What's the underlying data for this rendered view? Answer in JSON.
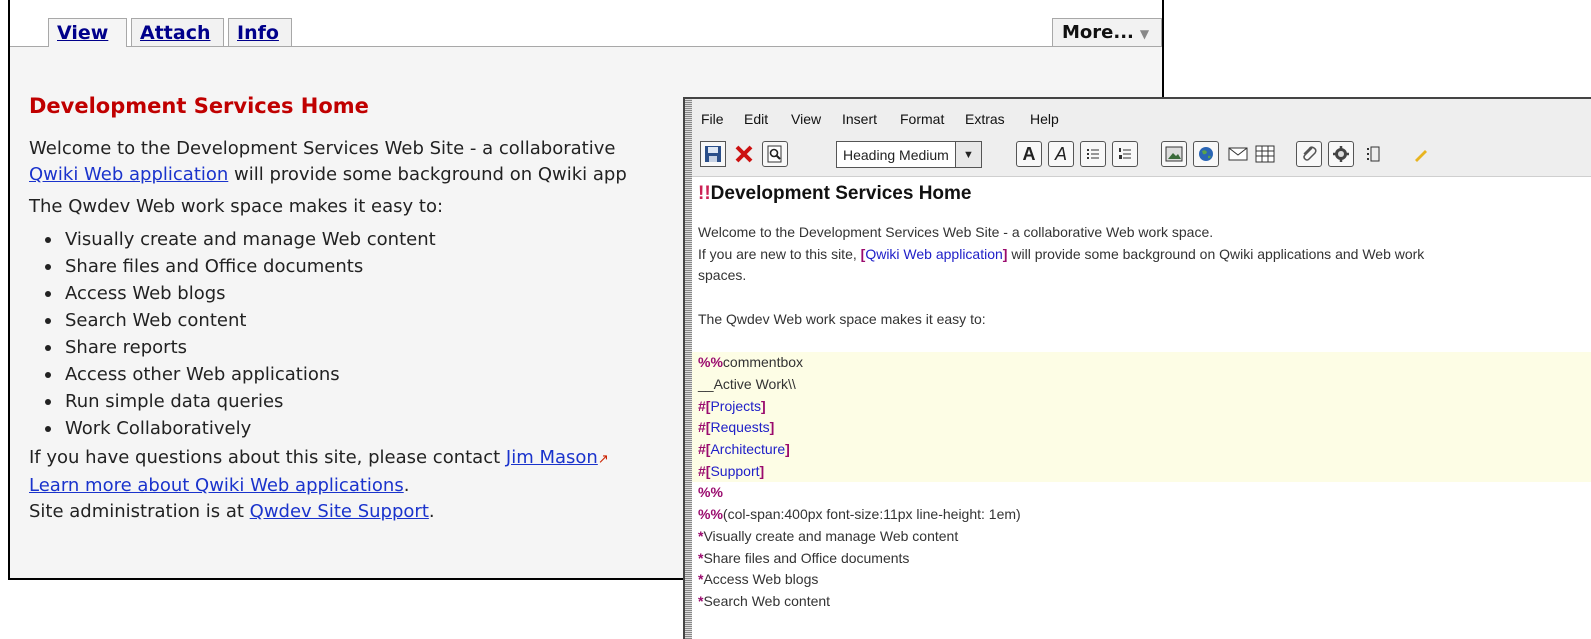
{
  "wiki": {
    "tabs": [
      {
        "label": "View",
        "active": true
      },
      {
        "label": "Attach",
        "active": false
      },
      {
        "label": "Info",
        "active": false
      }
    ],
    "more_label": "More...",
    "title": "Development Services Home",
    "welcome_text": "Welcome to the Development Services Web Site - a collaborative",
    "welcome_link": "Qwiki Web application",
    "welcome_tail": "will provide some background on Qwiki app",
    "intro": "The Qwdev Web work space makes it easy to:",
    "bullets": [
      "Visually create and manage Web content",
      "Share files and Office documents",
      "Access Web blogs",
      "Search Web content",
      "Share reports",
      "Access other Web applications",
      "Run simple data queries",
      "Work Collaboratively"
    ],
    "contact_text": "If you have questions about this site, please contact",
    "contact_link": "Jim Mason",
    "learn_link": "Learn more about Qwiki Web applications",
    "admin_text": "Site administration is at",
    "admin_link": "Qwdev Site Support"
  },
  "editor": {
    "menu": [
      "File",
      "Edit",
      "View",
      "Insert",
      "Format",
      "Extras",
      "Help"
    ],
    "style_select": "Heading Medium",
    "heading_markup": "!!",
    "heading_text": "Development Services  Home",
    "line1": "Welcome to the Development Services Web Site - a collaborative Web work space.",
    "line2_pre": "If you are new to this site,",
    "line2_link": "Qwiki Web application",
    "line2_post": "will provide some background on Qwiki applications and Web work",
    "line3": "spaces.",
    "line4": "The Qwdev Web work space makes it easy to:",
    "comment_markup": "%%",
    "comment_text": "commentbox",
    "active_work": "__Active Work\\\\",
    "hash_markup": "#",
    "links": [
      "Projects",
      "Requests",
      "Architecture",
      "Support"
    ],
    "close_markup": "%%",
    "style_markup": "%%",
    "style_text": "(col-span:400px font-size:11px line-height: 1em)",
    "star_markup": "*",
    "items": [
      "Visually create and manage Web content",
      "Share files and Office documents",
      "Access Web blogs",
      "Search Web content"
    ]
  }
}
